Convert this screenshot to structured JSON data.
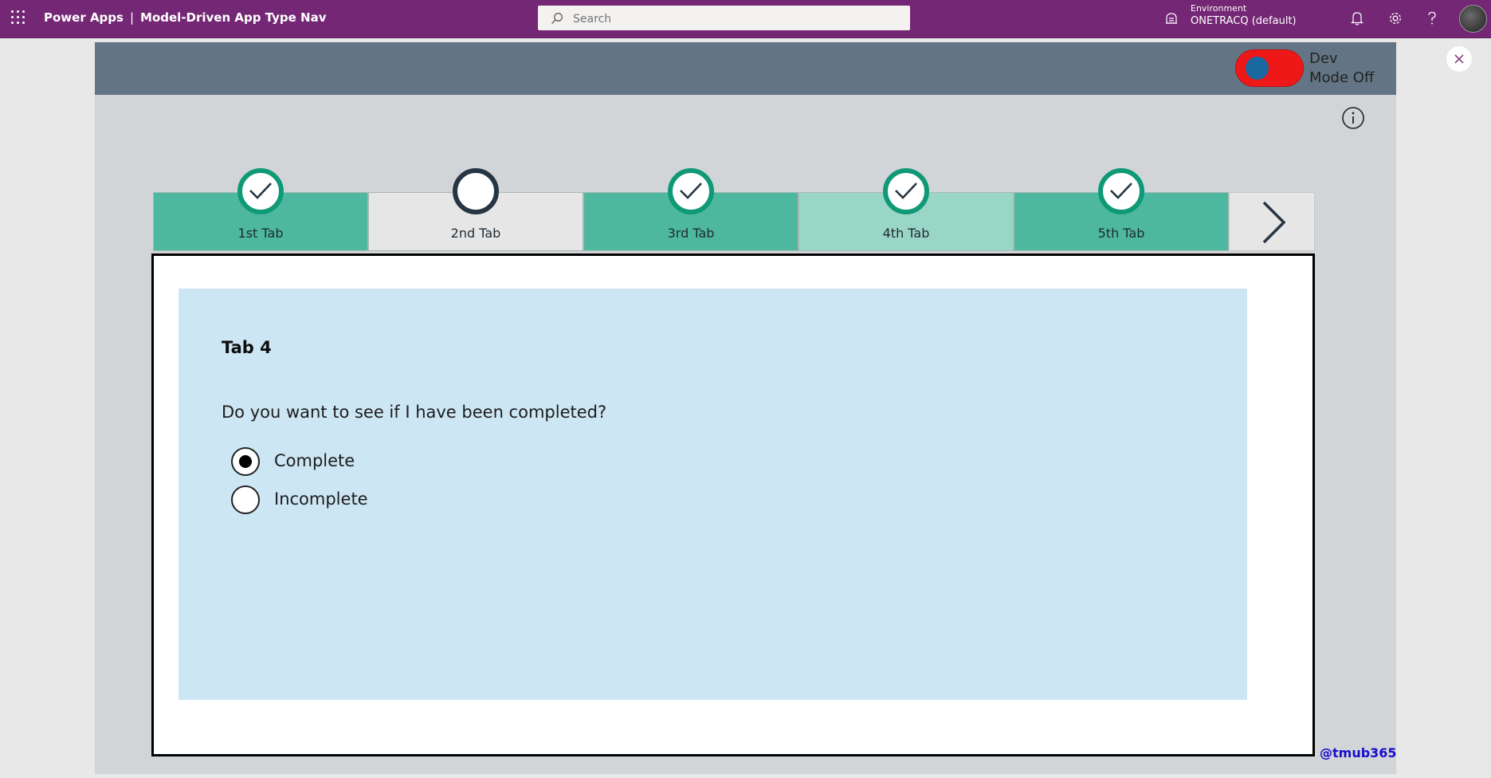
{
  "topbar": {
    "app_name": "Power Apps",
    "separator": "|",
    "app_title": "Model-Driven App Type Nav",
    "search_placeholder": "Search",
    "environment_label": "Environment",
    "environment_value": "ONETRACQ (default)",
    "icons": [
      "waffle-icon",
      "search-icon",
      "environment-icon",
      "bell-icon",
      "gear-icon",
      "help-icon",
      "avatar"
    ]
  },
  "app": {
    "dev_mode_label": "Dev Mode Off",
    "dev_mode_on": false,
    "toggle_color": "#ef1818",
    "header_color": "#637584"
  },
  "tabs": [
    {
      "label": "1st Tab",
      "state": "complete",
      "bg": "#4db89f"
    },
    {
      "label": "2nd Tab",
      "state": "incomplete",
      "bg": "#e6e6e6"
    },
    {
      "label": "3rd Tab",
      "state": "complete",
      "bg": "#4db89f"
    },
    {
      "label": "4th Tab",
      "state": "complete",
      "bg": "#9ad6c6",
      "selected": true
    },
    {
      "label": "5th Tab",
      "state": "complete",
      "bg": "#4db89f"
    }
  ],
  "content": {
    "title": "Tab 4",
    "question": "Do you want to see if I have been completed?",
    "options": [
      {
        "label": "Complete",
        "selected": true
      },
      {
        "label": "Incomplete",
        "selected": false
      }
    ],
    "panel_color": "#cce6f4"
  },
  "credit": "@tmub365"
}
